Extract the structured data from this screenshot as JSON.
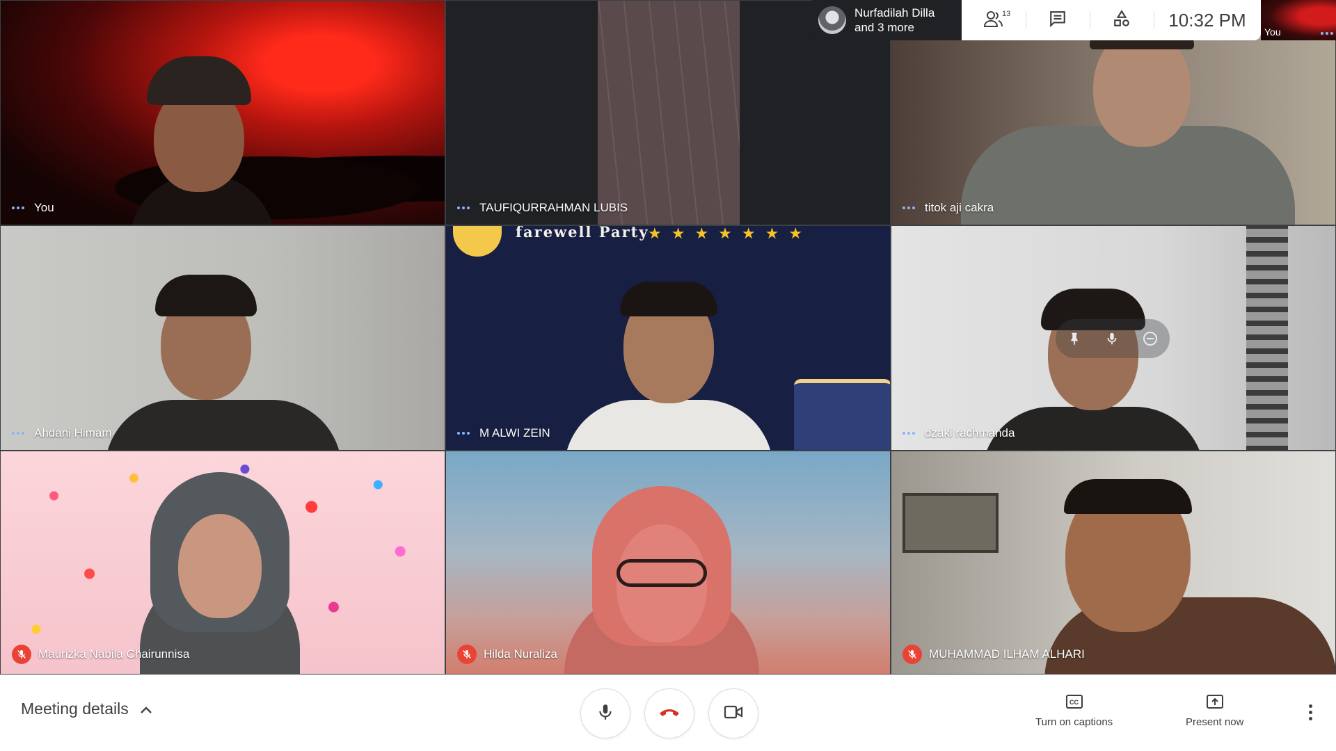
{
  "top": {
    "presenter_line1": "Nurfadilah Dilla",
    "presenter_line2": "and 3 more",
    "people_count": "13",
    "time": "10:32  PM",
    "self_label": "You"
  },
  "tiles": [
    {
      "name": "You",
      "muted": false
    },
    {
      "name": "TAUFIQURRAHMAN LUBIS",
      "muted": false
    },
    {
      "name": "titok aji cakra",
      "muted": false
    },
    {
      "name": "Ahdani Himam",
      "muted": false
    },
    {
      "name": "M ALWI ZEIN",
      "muted": false,
      "banner": "farewell Party"
    },
    {
      "name": "dzaki rachmanda",
      "muted": false
    },
    {
      "name": "Maurizka Nabila Chairunnisa",
      "muted": true
    },
    {
      "name": "Hilda Nuraliza",
      "muted": true
    },
    {
      "name": "MUHAMMAD ILHAM ALHARI",
      "muted": true
    }
  ],
  "bottom": {
    "meeting_details": "Meeting details",
    "captions": "Turn on captions",
    "present": "Present now"
  },
  "icons": {
    "people": "people-icon",
    "chat": "chat-icon",
    "activities": "shapes-icon",
    "mic": "mic-icon",
    "end_call": "end-call-icon",
    "camera": "camera-icon",
    "captions": "cc-icon",
    "present": "present-icon",
    "more": "more-vert-icon"
  },
  "colors": {
    "mute_red": "#ea4335",
    "end_call_red": "#d93025",
    "speaking_dots": "#8ab4f8"
  }
}
